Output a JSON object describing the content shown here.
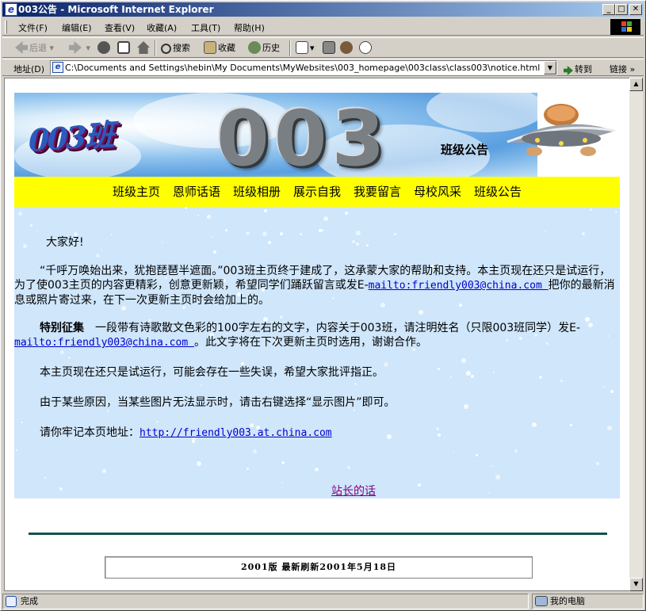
{
  "window": {
    "title": "003公告 - Microsoft Internet Explorer",
    "minimize": "_",
    "maximize": "□",
    "close": "✕"
  },
  "menu": [
    "文件(F)",
    "编辑(E)",
    "查看(V)",
    "收藏(A)",
    "工具(T)",
    "帮助(H)"
  ],
  "toolbar": {
    "back": "后退",
    "search": "搜索",
    "favorites": "收藏",
    "history": "历史"
  },
  "address": {
    "label": "地址(D)",
    "url": "C:\\Documents and Settings\\hebin\\My Documents\\MyWebsites\\003_homepage\\003class\\class003\\notice.html",
    "go": "转到",
    "links": "链接"
  },
  "banner": {
    "logo": "003班",
    "number": "003",
    "section_title": "班级公告"
  },
  "nav": [
    "班级主页",
    "恩师话语",
    "班级相册",
    "展示自我",
    "我要留言",
    "母校风采",
    "班级公告"
  ],
  "content": {
    "greeting": "大家好!",
    "p1_text": "“千呼万唤始出来，犹抱琵琶半遮面。”003班主页终于建成了，这承蒙大家的帮助和支持。本主页现在还只是试运行，为了使003主页的内容更精彩，创意更新颖，希望同学们踊跃留言或发E-",
    "p1_link": "mailto:friendly003@china.com ",
    "p1_tail": " 把你的最新消息或照片寄过来，在下一次更新主页时会给加上的。",
    "p2_bold": "特别征集",
    "p2_text": "　一段带有诗歌散文色彩的100字左右的文字，内容关于003班，请注明姓名（只限003班同学）发E-",
    "p2_link": "mailto:friendly003@china.com ",
    "p2_tail": "。此文字将在下次更新主页时选用，谢谢合作。",
    "p3": "本主页现在还只是试运行，可能会存在一些失误，希望大家批评指正。",
    "p4": "由于某些原因，当某些图片无法显示时，请击右键选择“显示图片”即可。",
    "p5_text": "请你牢记本页地址：",
    "p5_link": "http://friendly003.at.china.com",
    "webmaster": "站长的话"
  },
  "footer": {
    "updated": "2001版 最新刷新2001年5月18日"
  },
  "status": {
    "left": "完成",
    "right": "我的电脑"
  }
}
